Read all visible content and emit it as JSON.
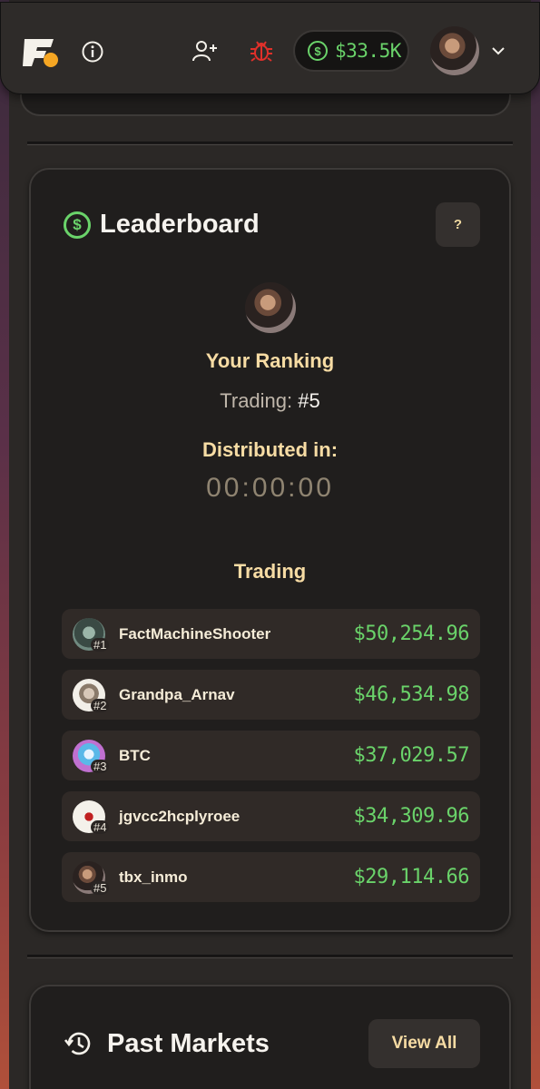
{
  "header": {
    "balance": "$33.5K",
    "balance_symbol": "$",
    "icons": [
      "logo",
      "info-icon",
      "add-user-icon",
      "bug-icon",
      "dollar-circle-icon",
      "avatar",
      "chevron-down-icon"
    ],
    "colors": {
      "accent_green": "#6ad36a",
      "bug_red": "#e0302a",
      "logo_orange": "#f5a623"
    }
  },
  "leaderboard": {
    "title": "Leaderboard",
    "title_icon_symbol": "$",
    "help_label": "?",
    "your_ranking_label": "Your Ranking",
    "trading_label": "Trading: ",
    "trading_rank": "#5",
    "distributed_label": "Distributed in:",
    "countdown": "00:00:00",
    "section_label": "Trading",
    "rows": [
      {
        "rank": "#1",
        "name": "FactMachineShooter",
        "value": "$50,254.96"
      },
      {
        "rank": "#2",
        "name": "Grandpa_Arnav",
        "value": "$46,534.98"
      },
      {
        "rank": "#3",
        "name": "BTC",
        "value": "$37,029.57"
      },
      {
        "rank": "#4",
        "name": "jgvcc2hcplyroee",
        "value": "$34,309.96"
      },
      {
        "rank": "#5",
        "name": "tbx_inmo",
        "value": "$29,114.66"
      }
    ]
  },
  "past_markets": {
    "title": "Past Markets",
    "view_all_label": "View All"
  }
}
